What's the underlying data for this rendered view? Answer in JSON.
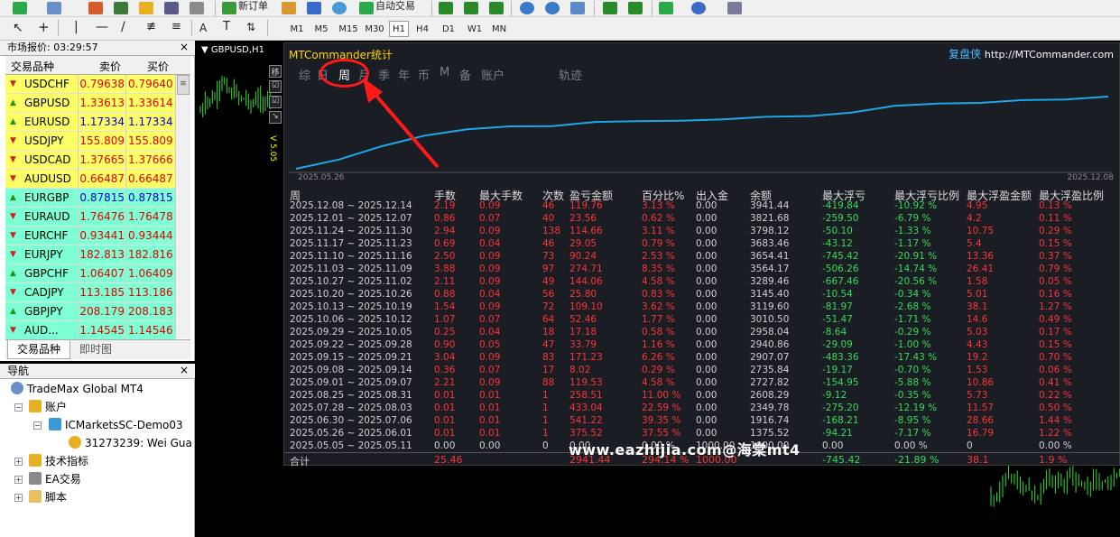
{
  "toolbar": {
    "new_order": "新订单",
    "auto_trading": "自动交易",
    "timeframes": [
      "M1",
      "M5",
      "M15",
      "M30",
      "H1",
      "H4",
      "D1",
      "W1",
      "MN"
    ],
    "active_timeframe": "H1"
  },
  "market_watch": {
    "title": "市场报价: 03:29:57",
    "col_symbol": "交易品种",
    "col_bid": "卖价",
    "col_ask": "买价",
    "rows": [
      {
        "symbol": "USDCHF",
        "bid": "0.79638",
        "ask": "0.79640",
        "dir": "down",
        "bg": "#ffff66",
        "color": "#e00000"
      },
      {
        "symbol": "GBPUSD",
        "bid": "1.33613",
        "ask": "1.33614",
        "dir": "up",
        "bg": "#ffff66",
        "color": "#e00000"
      },
      {
        "symbol": "EURUSD",
        "bid": "1.17334",
        "ask": "1.17334",
        "dir": "up",
        "bg": "#ffff66",
        "color": "#0000d0"
      },
      {
        "symbol": "USDJPY",
        "bid": "155.809",
        "ask": "155.809",
        "dir": "down",
        "bg": "#ffff66",
        "color": "#e00000"
      },
      {
        "symbol": "USDCAD",
        "bid": "1.37665",
        "ask": "1.37666",
        "dir": "down",
        "bg": "#ffff66",
        "color": "#e00000"
      },
      {
        "symbol": "AUDUSD",
        "bid": "0.66487",
        "ask": "0.66487",
        "dir": "down",
        "bg": "#ffff66",
        "color": "#e00000"
      },
      {
        "symbol": "EURGBP",
        "bid": "0.87815",
        "ask": "0.87815",
        "dir": "up",
        "bg": "#7fffd4",
        "color": "#0000d0"
      },
      {
        "symbol": "EURAUD",
        "bid": "1.76476",
        "ask": "1.76478",
        "dir": "down",
        "bg": "#7fffd4",
        "color": "#e00000"
      },
      {
        "symbol": "EURCHF",
        "bid": "0.93441",
        "ask": "0.93444",
        "dir": "down",
        "bg": "#7fffd4",
        "color": "#e00000"
      },
      {
        "symbol": "EURJPY",
        "bid": "182.813",
        "ask": "182.816",
        "dir": "down",
        "bg": "#7fffd4",
        "color": "#e00000"
      },
      {
        "symbol": "GBPCHF",
        "bid": "1.06407",
        "ask": "1.06409",
        "dir": "up",
        "bg": "#7fffd4",
        "color": "#e00000"
      },
      {
        "symbol": "CADJPY",
        "bid": "113.185",
        "ask": "113.186",
        "dir": "down",
        "bg": "#7fffd4",
        "color": "#e00000"
      },
      {
        "symbol": "GBPJPY",
        "bid": "208.179",
        "ask": "208.183",
        "dir": "up",
        "bg": "#7fffd4",
        "color": "#e00000"
      },
      {
        "symbol": "AUD...",
        "bid": "1.14545",
        "ask": "1.14546",
        "dir": "down",
        "bg": "#7fffd4",
        "color": "#e00000"
      }
    ],
    "tab_symbols": "交易品种",
    "tab_tick": "即时图"
  },
  "navigator": {
    "title": "导航",
    "root": "TradeMax Global MT4",
    "accounts": "账户",
    "server": "ICMarketsSC-Demo03",
    "account": "31273239: Wei Gua",
    "indicators": "技术指标",
    "experts": "EA交易",
    "scripts": "脚本"
  },
  "chart": {
    "tab_label": "GBPUSD,H1",
    "vol_label": "V 5.05"
  },
  "stats": {
    "title": "MTCommander统计",
    "brand": "复盘侠",
    "brand_url": "http://MTCommander.com",
    "tabs": [
      "综",
      "日",
      "周",
      "月",
      "季",
      "年",
      "币",
      "M",
      "备",
      "账户",
      "轨迹"
    ],
    "active_tab": "周",
    "chart_start": "2025.05.26",
    "chart_end": "2025.12.08",
    "headers": [
      "周",
      "手数",
      "最大手数",
      "次数",
      "盈亏金额",
      "百分比%",
      "出入金",
      "余额",
      "最大浮亏",
      "最大浮亏比例",
      "最大浮盈金额",
      "最大浮盈比例"
    ],
    "rows": [
      [
        "2025.12.08 ~ 2025.12.14",
        "2.19",
        "0.09",
        "46",
        "119.76",
        "3.13 %",
        "0.00",
        "3941.44",
        "-419.84",
        "-10.92 %",
        "4.95",
        "0.13 %"
      ],
      [
        "2025.12.01 ~ 2025.12.07",
        "0.86",
        "0.07",
        "40",
        "23.56",
        "0.62 %",
        "0.00",
        "3821.68",
        "-259.50",
        "-6.79 %",
        "4.2",
        "0.11 %"
      ],
      [
        "2025.11.24 ~ 2025.11.30",
        "2.94",
        "0.09",
        "138",
        "114.66",
        "3.11 %",
        "0.00",
        "3798.12",
        "-50.10",
        "-1.33 %",
        "10.75",
        "0.29 %"
      ],
      [
        "2025.11.17 ~ 2025.11.23",
        "0.69",
        "0.04",
        "46",
        "29.05",
        "0.79 %",
        "0.00",
        "3683.46",
        "-43.12",
        "-1.17 %",
        "5.4",
        "0.15 %"
      ],
      [
        "2025.11.10 ~ 2025.11.16",
        "2.50",
        "0.09",
        "73",
        "90.24",
        "2.53 %",
        "0.00",
        "3654.41",
        "-745.42",
        "-20.91 %",
        "13.36",
        "0.37 %"
      ],
      [
        "2025.11.03 ~ 2025.11.09",
        "3.88",
        "0.09",
        "97",
        "274.71",
        "8.35 %",
        "0.00",
        "3564.17",
        "-506.26",
        "-14.74 %",
        "26.41",
        "0.79 %"
      ],
      [
        "2025.10.27 ~ 2025.11.02",
        "2.11",
        "0.09",
        "49",
        "144.06",
        "4.58 %",
        "0.00",
        "3289.46",
        "-667.46",
        "-20.56 %",
        "1.58",
        "0.05 %"
      ],
      [
        "2025.10.20 ~ 2025.10.26",
        "0.88",
        "0.04",
        "56",
        "25.80",
        "0.83 %",
        "0.00",
        "3145.40",
        "-10.54",
        "-0.34 %",
        "5.01",
        "0.16 %"
      ],
      [
        "2025.10.13 ~ 2025.10.19",
        "1.54",
        "0.09",
        "72",
        "109.10",
        "3.62 %",
        "0.00",
        "3119.60",
        "-81.97",
        "-2.68 %",
        "38.1",
        "1.27 %"
      ],
      [
        "2025.10.06 ~ 2025.10.12",
        "1.07",
        "0.07",
        "64",
        "52.46",
        "1.77 %",
        "0.00",
        "3010.50",
        "-51.47",
        "-1.71 %",
        "14.6",
        "0.49 %"
      ],
      [
        "2025.09.29 ~ 2025.10.05",
        "0.25",
        "0.04",
        "18",
        "17.18",
        "0.58 %",
        "0.00",
        "2958.04",
        "-8.64",
        "-0.29 %",
        "5.03",
        "0.17 %"
      ],
      [
        "2025.09.22 ~ 2025.09.28",
        "0.90",
        "0.05",
        "47",
        "33.79",
        "1.16 %",
        "0.00",
        "2940.86",
        "-29.09",
        "-1.00 %",
        "4.43",
        "0.15 %"
      ],
      [
        "2025.09.15 ~ 2025.09.21",
        "3.04",
        "0.09",
        "83",
        "171.23",
        "6.26 %",
        "0.00",
        "2907.07",
        "-483.36",
        "-17.43 %",
        "19.2",
        "0.70 %"
      ],
      [
        "2025.09.08 ~ 2025.09.14",
        "0.36",
        "0.07",
        "17",
        "8.02",
        "0.29 %",
        "0.00",
        "2735.84",
        "-19.17",
        "-0.70 %",
        "1.53",
        "0.06 %"
      ],
      [
        "2025.09.01 ~ 2025.09.07",
        "2.21",
        "0.09",
        "88",
        "119.53",
        "4.58 %",
        "0.00",
        "2727.82",
        "-154.95",
        "-5.88 %",
        "10.86",
        "0.41 %"
      ],
      [
        "2025.08.25 ~ 2025.08.31",
        "0.01",
        "0.01",
        "1",
        "258.51",
        "11.00 %",
        "0.00",
        "2608.29",
        "-9.12",
        "-0.35 %",
        "5.73",
        "0.22 %"
      ],
      [
        "2025.07.28 ~ 2025.08.03",
        "0.01",
        "0.01",
        "1",
        "433.04",
        "22.59 %",
        "0.00",
        "2349.78",
        "-275.20",
        "-12.19 %",
        "11.57",
        "0.50 %"
      ],
      [
        "2025.06.30 ~ 2025.07.06",
        "0.01",
        "0.01",
        "1",
        "541.22",
        "39.35 %",
        "0.00",
        "1916.74",
        "-168.21",
        "-8.95 %",
        "28.66",
        "1.44 %"
      ],
      [
        "2025.05.26 ~ 2025.06.01",
        "0.01",
        "0.01",
        "1",
        "375.52",
        "37.55 %",
        "0.00",
        "1375.52",
        "-94.21",
        "-7.17 %",
        "16.79",
        "1.22 %"
      ],
      [
        "2025.05.05 ~ 2025.05.11",
        "0.00",
        "0.00",
        "0",
        "0.00",
        "0.00 %",
        "1000.00",
        "1000.00",
        "0.00",
        "0.00 %",
        "0",
        "0.00 %"
      ]
    ],
    "total": [
      "合计",
      "25.46",
      "",
      "",
      "2941.44",
      "294.14 %",
      "1000.00",
      "",
      "-745.42",
      "-21.89 %",
      "38.1",
      "1.9 %"
    ]
  },
  "watermark": "www.eazhijia.com@海棠mt4",
  "colors": {
    "panel_bg": "#1a1d23",
    "equity_line": "#1fa8e8",
    "positive": "#ff3333",
    "negative": "#33dd55"
  }
}
